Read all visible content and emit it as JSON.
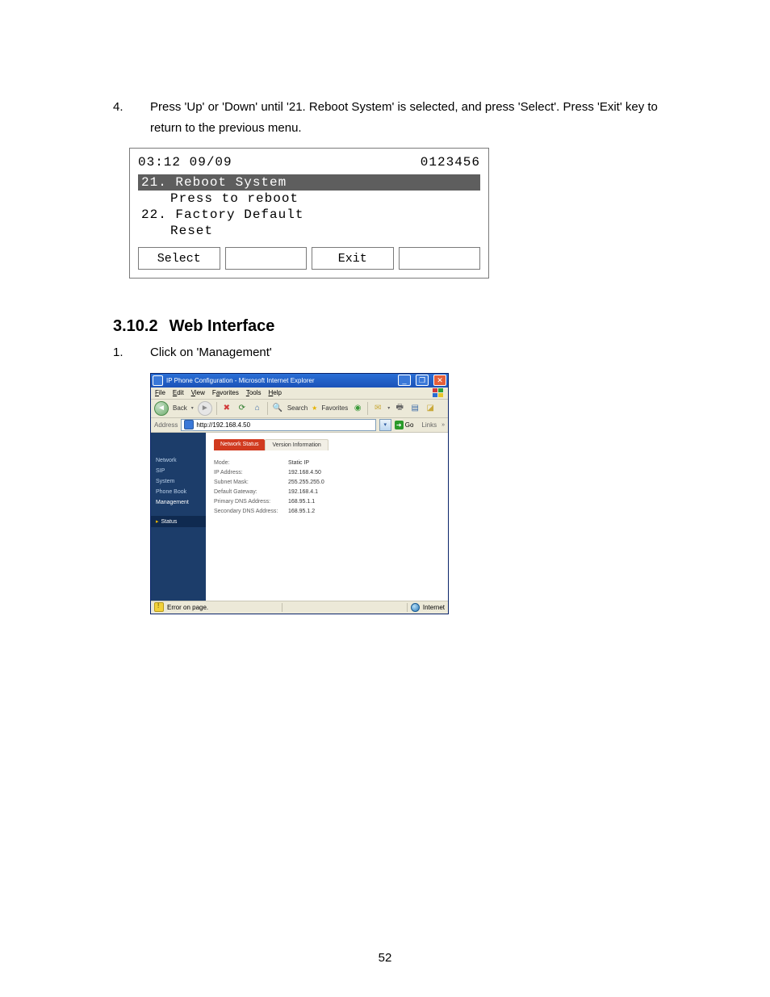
{
  "step4": {
    "num": "4.",
    "text": "Press 'Up' or 'Down' until '21. Reboot System' is selected, and press 'Select'.   Press 'Exit' key to return to the previous menu."
  },
  "lcd": {
    "time": "03:12 09/09",
    "code": "0123456",
    "selected": "21. Reboot System",
    "line1": "Press to reboot",
    "item22": "22. Factory Default",
    "item22b": "Reset",
    "btn_select": "Select",
    "btn_exit": "Exit"
  },
  "heading": {
    "num": "3.10.2",
    "title": "Web Interface"
  },
  "step1": {
    "num": "1.",
    "text": "Click on 'Management'"
  },
  "ie": {
    "title": "IP Phone Configuration - Microsoft Internet Explorer",
    "menu": {
      "file": "File",
      "edit": "Edit",
      "view": "View",
      "favorites": "Favorites",
      "tools": "Tools",
      "help": "Help"
    },
    "tool": {
      "back": "Back",
      "search": "Search",
      "favorites": "Favorites"
    },
    "addr": {
      "label": "Address",
      "url": "http://192.168.4.50",
      "go": "Go",
      "links": "Links"
    },
    "side": {
      "network": "Network",
      "sip": "SIP",
      "system": "System",
      "phonebook": "Phone Book",
      "management": "Management",
      "status": "Status"
    },
    "tabs": {
      "net": "Network Status",
      "ver": "Version Information"
    },
    "rows": {
      "mode_k": "Mode:",
      "mode_v": "Static IP",
      "ip_k": "IP Address:",
      "ip_v": "192.168.4.50",
      "mask_k": "Subnet Mask:",
      "mask_v": "255.255.255.0",
      "gw_k": "Default Gateway:",
      "gw_v": "192.168.4.1",
      "dns1_k": "Primary DNS Address:",
      "dns1_v": "168.95.1.1",
      "dns2_k": "Secondary DNS Address:",
      "dns2_v": "168.95.1.2"
    },
    "status": {
      "err": "Error on page.",
      "zone": "Internet"
    }
  },
  "page_num": "52"
}
